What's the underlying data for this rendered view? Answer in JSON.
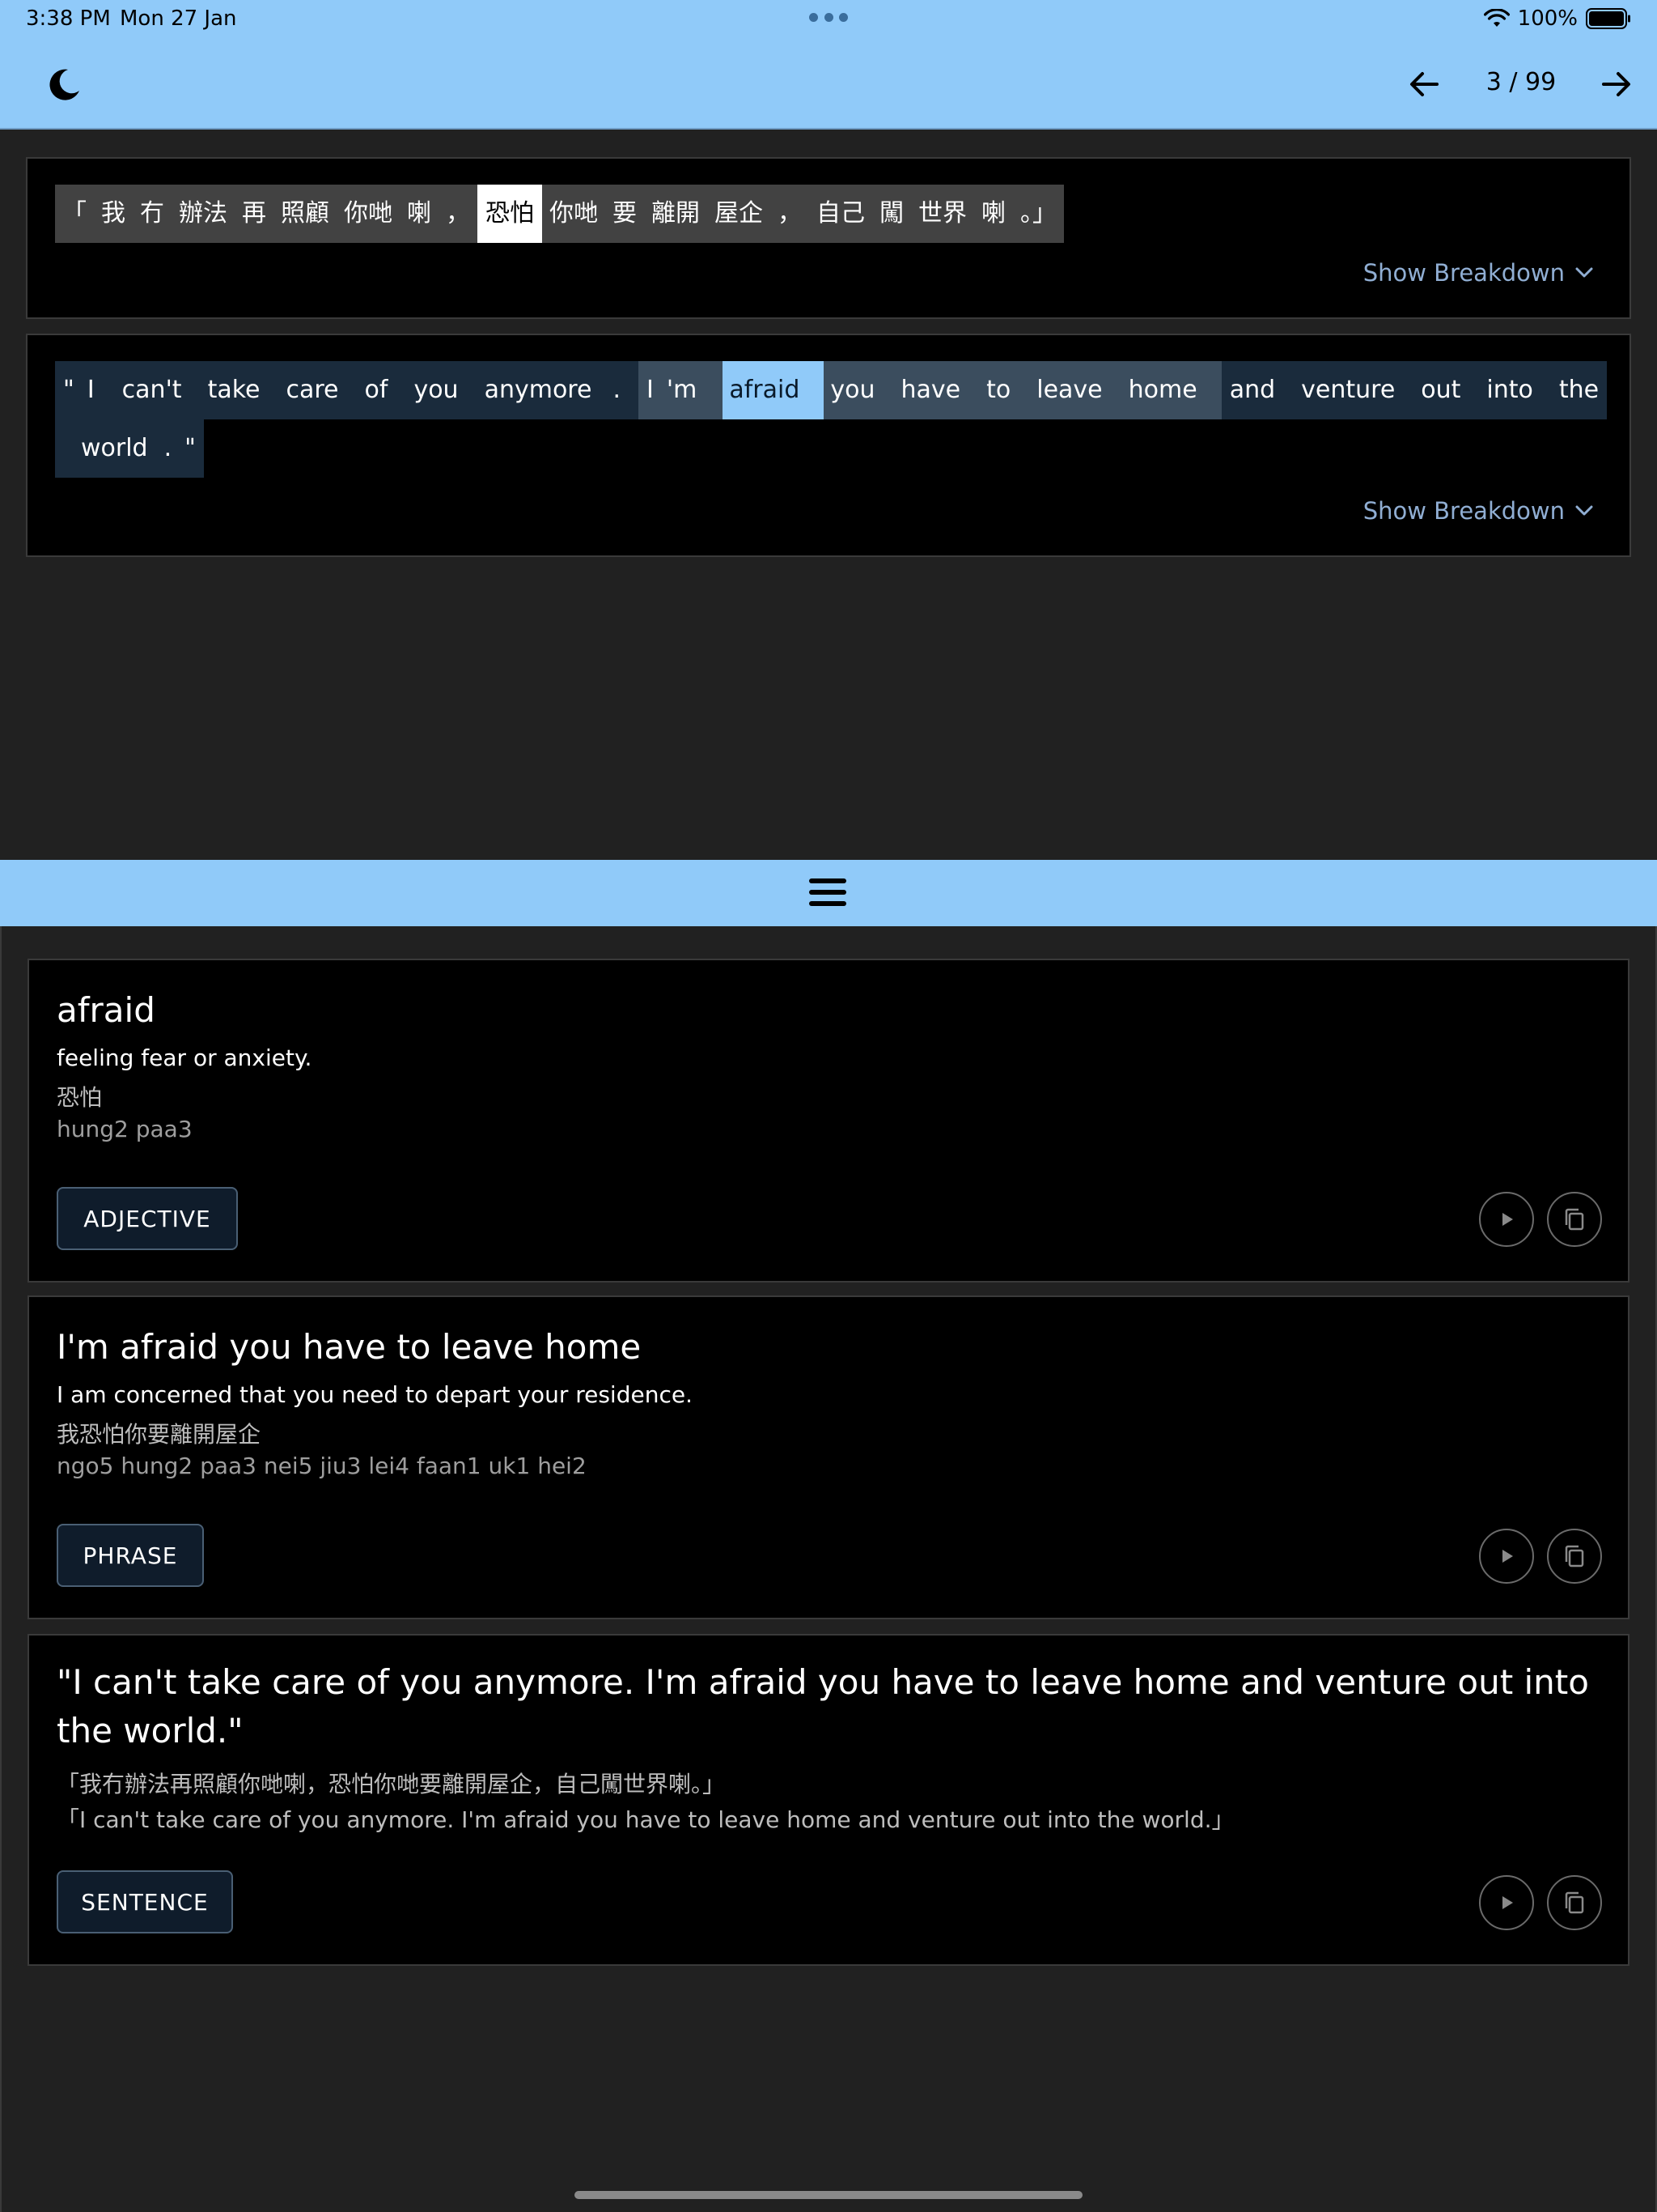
{
  "status": {
    "time": "3:38 PM",
    "date": "Mon 27 Jan",
    "battery": "100%"
  },
  "toolbar": {
    "page_counter": "3 / 99"
  },
  "source_sentence": {
    "tokens": [
      "「",
      "我",
      "冇",
      "辦法",
      "再",
      "照顧",
      "你哋",
      "喇",
      "，",
      "恐怕",
      "你哋",
      "要",
      "離開",
      "屋企",
      "，",
      "自己",
      "闖",
      "世界",
      "喇",
      "。」"
    ],
    "breakdown_label": "Show Breakdown"
  },
  "target_sentence": {
    "row1_before": [
      "\"",
      "I",
      "can't",
      "take",
      "care",
      "of",
      "you",
      "anymore",
      "."
    ],
    "row1_group": [
      "I",
      "'m",
      "afraid",
      "you",
      "have",
      "to",
      "leave",
      "home"
    ],
    "row1_after": [
      "and",
      "venture",
      "out",
      "into",
      "the"
    ],
    "row2": [
      "world",
      ".",
      "\""
    ],
    "breakdown_label": "Show Breakdown"
  },
  "entries": [
    {
      "title": "afraid",
      "definition": "feeling fear or anxiety.",
      "chinese": "恐怕",
      "jyutping": "hung2 paa3",
      "pos": "ADJECTIVE"
    },
    {
      "title": "I'm afraid you have to leave home",
      "definition": "I am concerned that you need to depart your residence.",
      "chinese": "我恐怕你要離開屋企",
      "jyutping": "ngo5 hung2 paa3 nei5 jiu3 lei4 faan1 uk1 hei2",
      "pos": "PHRASE"
    },
    {
      "title": "\"I can't take care of you anymore. I'm afraid you have to leave home and venture out into the world.\"",
      "chinese": "「我冇辦法再照顧你哋喇，恐怕你哋要離開屋企，自己闖世界喇。」",
      "english": "「I can't take care of you anymore. I'm afraid you have to leave home and venture out into the world.」",
      "pos": "SENTENCE"
    }
  ],
  "colors": {
    "accent": "#90caf9",
    "background": "#212121",
    "card": "#000000"
  }
}
